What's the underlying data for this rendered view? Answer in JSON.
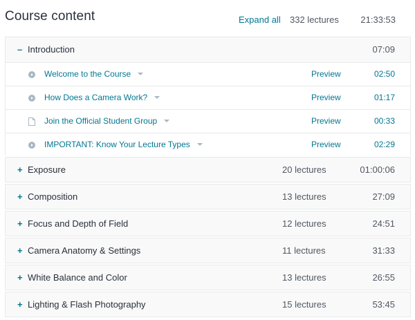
{
  "header": {
    "title": "Course content",
    "expand_label": "Expand all",
    "lecture_count": "332 lectures",
    "total_duration": "21:33:53"
  },
  "colors": {
    "accent": "#007791",
    "text": "#29303b",
    "muted": "#505763",
    "section_bg": "#f9f9f9",
    "border": "#e8e9eb"
  },
  "intro": {
    "toggle": "–",
    "title": "Introduction",
    "duration": "07:09",
    "lectures": [
      {
        "icon": "play-circle-icon",
        "title": "Welcome to the Course",
        "preview": "Preview",
        "duration": "02:50"
      },
      {
        "icon": "play-circle-icon",
        "title": "How Does a Camera Work?",
        "preview": "Preview",
        "duration": "01:17"
      },
      {
        "icon": "document-icon",
        "title": "Join the Official Student Group",
        "preview": "Preview",
        "duration": "00:33"
      },
      {
        "icon": "play-circle-icon",
        "title": "IMPORTANT: Know Your Lecture Types",
        "preview": "Preview",
        "duration": "02:29"
      }
    ]
  },
  "sections": [
    {
      "toggle": "+",
      "title": "Exposure",
      "count": "20 lectures",
      "duration": "01:00:06"
    },
    {
      "toggle": "+",
      "title": "Composition",
      "count": "13 lectures",
      "duration": "27:09"
    },
    {
      "toggle": "+",
      "title": "Focus and Depth of Field",
      "count": "12 lectures",
      "duration": "24:51"
    },
    {
      "toggle": "+",
      "title": "Camera Anatomy & Settings",
      "count": "11 lectures",
      "duration": "31:33"
    },
    {
      "toggle": "+",
      "title": "White Balance and Color",
      "count": "13 lectures",
      "duration": "26:55"
    },
    {
      "toggle": "+",
      "title": "Lighting & Flash Photography",
      "count": "15 lectures",
      "duration": "53:45"
    }
  ]
}
